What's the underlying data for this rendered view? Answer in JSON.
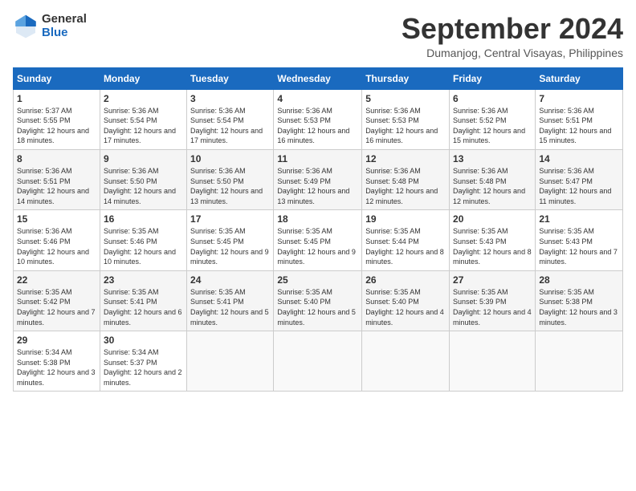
{
  "header": {
    "logo_general": "General",
    "logo_blue": "Blue",
    "month_title": "September 2024",
    "location": "Dumanjog, Central Visayas, Philippines"
  },
  "calendar": {
    "days_of_week": [
      "Sunday",
      "Monday",
      "Tuesday",
      "Wednesday",
      "Thursday",
      "Friday",
      "Saturday"
    ],
    "weeks": [
      [
        {
          "day": "",
          "info": ""
        },
        {
          "day": "2",
          "info": "Sunrise: 5:36 AM\nSunset: 5:54 PM\nDaylight: 12 hours\nand 17 minutes."
        },
        {
          "day": "3",
          "info": "Sunrise: 5:36 AM\nSunset: 5:54 PM\nDaylight: 12 hours\nand 17 minutes."
        },
        {
          "day": "4",
          "info": "Sunrise: 5:36 AM\nSunset: 5:53 PM\nDaylight: 12 hours\nand 16 minutes."
        },
        {
          "day": "5",
          "info": "Sunrise: 5:36 AM\nSunset: 5:53 PM\nDaylight: 12 hours\nand 16 minutes."
        },
        {
          "day": "6",
          "info": "Sunrise: 5:36 AM\nSunset: 5:52 PM\nDaylight: 12 hours\nand 15 minutes."
        },
        {
          "day": "7",
          "info": "Sunrise: 5:36 AM\nSunset: 5:51 PM\nDaylight: 12 hours\nand 15 minutes."
        }
      ],
      [
        {
          "day": "1",
          "info": "Sunrise: 5:37 AM\nSunset: 5:55 PM\nDaylight: 12 hours\nand 18 minutes."
        },
        {
          "day": "9",
          "info": "Sunrise: 5:36 AM\nSunset: 5:50 PM\nDaylight: 12 hours\nand 14 minutes."
        },
        {
          "day": "10",
          "info": "Sunrise: 5:36 AM\nSunset: 5:50 PM\nDaylight: 12 hours\nand 13 minutes."
        },
        {
          "day": "11",
          "info": "Sunrise: 5:36 AM\nSunset: 5:49 PM\nDaylight: 12 hours\nand 13 minutes."
        },
        {
          "day": "12",
          "info": "Sunrise: 5:36 AM\nSunset: 5:48 PM\nDaylight: 12 hours\nand 12 minutes."
        },
        {
          "day": "13",
          "info": "Sunrise: 5:36 AM\nSunset: 5:48 PM\nDaylight: 12 hours\nand 12 minutes."
        },
        {
          "day": "14",
          "info": "Sunrise: 5:36 AM\nSunset: 5:47 PM\nDaylight: 12 hours\nand 11 minutes."
        }
      ],
      [
        {
          "day": "8",
          "info": "Sunrise: 5:36 AM\nSunset: 5:51 PM\nDaylight: 12 hours\nand 14 minutes."
        },
        {
          "day": "16",
          "info": "Sunrise: 5:35 AM\nSunset: 5:46 PM\nDaylight: 12 hours\nand 10 minutes."
        },
        {
          "day": "17",
          "info": "Sunrise: 5:35 AM\nSunset: 5:45 PM\nDaylight: 12 hours\nand 9 minutes."
        },
        {
          "day": "18",
          "info": "Sunrise: 5:35 AM\nSunset: 5:45 PM\nDaylight: 12 hours\nand 9 minutes."
        },
        {
          "day": "19",
          "info": "Sunrise: 5:35 AM\nSunset: 5:44 PM\nDaylight: 12 hours\nand 8 minutes."
        },
        {
          "day": "20",
          "info": "Sunrise: 5:35 AM\nSunset: 5:43 PM\nDaylight: 12 hours\nand 8 minutes."
        },
        {
          "day": "21",
          "info": "Sunrise: 5:35 AM\nSunset: 5:43 PM\nDaylight: 12 hours\nand 7 minutes."
        }
      ],
      [
        {
          "day": "15",
          "info": "Sunrise: 5:36 AM\nSunset: 5:46 PM\nDaylight: 12 hours\nand 10 minutes."
        },
        {
          "day": "23",
          "info": "Sunrise: 5:35 AM\nSunset: 5:41 PM\nDaylight: 12 hours\nand 6 minutes."
        },
        {
          "day": "24",
          "info": "Sunrise: 5:35 AM\nSunset: 5:41 PM\nDaylight: 12 hours\nand 5 minutes."
        },
        {
          "day": "25",
          "info": "Sunrise: 5:35 AM\nSunset: 5:40 PM\nDaylight: 12 hours\nand 5 minutes."
        },
        {
          "day": "26",
          "info": "Sunrise: 5:35 AM\nSunset: 5:40 PM\nDaylight: 12 hours\nand 4 minutes."
        },
        {
          "day": "27",
          "info": "Sunrise: 5:35 AM\nSunset: 5:39 PM\nDaylight: 12 hours\nand 4 minutes."
        },
        {
          "day": "28",
          "info": "Sunrise: 5:35 AM\nSunset: 5:38 PM\nDaylight: 12 hours\nand 3 minutes."
        }
      ],
      [
        {
          "day": "22",
          "info": "Sunrise: 5:35 AM\nSunset: 5:42 PM\nDaylight: 12 hours\nand 7 minutes."
        },
        {
          "day": "30",
          "info": "Sunrise: 5:34 AM\nSunset: 5:37 PM\nDaylight: 12 hours\nand 2 minutes."
        },
        {
          "day": "",
          "info": ""
        },
        {
          "day": "",
          "info": ""
        },
        {
          "day": "",
          "info": ""
        },
        {
          "day": "",
          "info": ""
        },
        {
          "day": ""
        }
      ],
      [
        {
          "day": "29",
          "info": "Sunrise: 5:34 AM\nSunset: 5:38 PM\nDaylight: 12 hours\nand 3 minutes."
        },
        {
          "day": "",
          "info": ""
        },
        {
          "day": "",
          "info": ""
        },
        {
          "day": "",
          "info": ""
        },
        {
          "day": "",
          "info": ""
        },
        {
          "day": "",
          "info": ""
        },
        {
          "day": "",
          "info": ""
        }
      ]
    ]
  }
}
